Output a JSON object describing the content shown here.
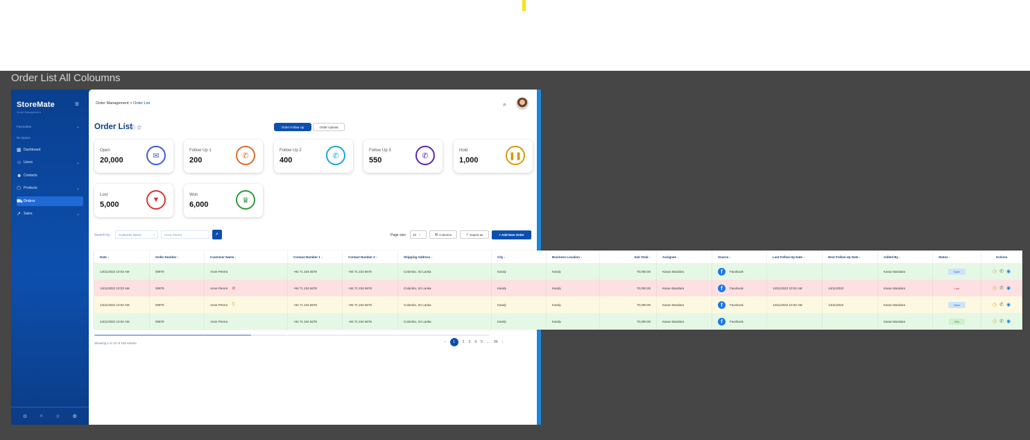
{
  "frame_title": "Order List All Coloumns",
  "sidebar": {
    "logo": "StoreMate",
    "logo_sub": "Order Management",
    "items": [
      {
        "label": "Favourites"
      },
      {
        "label": "No Space"
      },
      {
        "label": "Dashboard"
      },
      {
        "label": "Users"
      },
      {
        "label": "Contacts"
      },
      {
        "label": "Products"
      },
      {
        "label": "Orders"
      },
      {
        "label": "Sales"
      }
    ]
  },
  "header": {
    "breadcrumb_root": "Order Management",
    "breadcrumb_sep": ">",
    "breadcrumb_current": "Order List"
  },
  "page": {
    "title": "Order List",
    "tabs": [
      "Order Follow Up",
      "Order Upload"
    ]
  },
  "stats": [
    {
      "label": "Open",
      "value": "20,000",
      "color": "#3d5bd9"
    },
    {
      "label": "Follow Up 1",
      "value": "200",
      "color": "#e06a2c"
    },
    {
      "label": "Follow Up 2",
      "value": "400",
      "color": "#1aa6d8"
    },
    {
      "label": "Follow Up 3",
      "value": "550",
      "color": "#5a23b3"
    },
    {
      "label": "Hold",
      "value": "1,000",
      "color": "#d49a0d"
    },
    {
      "label": "Lost",
      "value": "5,000",
      "color": "#d93434"
    },
    {
      "label": "Won",
      "value": "6,000",
      "color": "#2e9a3a"
    }
  ],
  "toolbar": {
    "search_by": "Search by",
    "search_field": "Customer Name",
    "search_placeholder": "Anne Perera",
    "page_size_label": "Page size",
    "page_size_value": "10",
    "columns_label": "Columns",
    "export_label": "Export as",
    "add_label": "+ Add New Order"
  },
  "table": {
    "headers": [
      "Date ↓",
      "Order Number ↓",
      "Customer Name ↓",
      "Contact Number 1 ↓",
      "Contact Number 2 ↓",
      "Shipping Address ↓",
      "City ↓",
      "Business Location ↓",
      "Sub Total ↓",
      "Assignee ↓",
      "Source ↓",
      "Last Follow Up Date ↓",
      "Next Follow Up Date ↓",
      "Added By ↓",
      "Status ↓",
      "Actions"
    ],
    "rows": [
      {
        "date": "14/11/2022 10:02 AM",
        "order": "00879",
        "customer": "Anne Perera",
        "c1": "+94 71 234 5678",
        "c2": "+94 71 234 5678",
        "address": "Colombo, Sri Lanka",
        "city": "Kandy",
        "location": "Kandy",
        "subtotal": "70,000.00",
        "assignee": "Kasun Bandara",
        "source": "Facebook",
        "last": "",
        "next": "",
        "added_by": "Kasun Bandara",
        "status": "Open",
        "bg": "#e5f8e5",
        "status_bg": "#cfe3fb",
        "status_color": "#2f5fb0"
      },
      {
        "date": "14/11/2022 10:02 AM",
        "order": "00879",
        "customer": "Anne Perera",
        "c1": "+94 71 234 5678",
        "c2": "+94 71 234 5678",
        "address": "Colombo, Sri Lanka",
        "city": "Kandy",
        "location": "Kandy",
        "subtotal": "70,000.00",
        "assignee": "Kasun Bandara",
        "source": "Facebook",
        "last": "14/11/2022 10:02 AM",
        "next": "14/11/2022",
        "added_by": "Kasun Bandara",
        "status": "Lost",
        "bg": "#fde0e2",
        "status_bg": "#fde0e2",
        "status_color": "#c7333a"
      },
      {
        "date": "14/11/2022 10:02 AM",
        "order": "00879",
        "customer": "Anne Perera",
        "c1": "+94 71 234 5678",
        "c2": "+94 71 234 5678",
        "address": "Colombo, Sri Lanka",
        "city": "Kandy",
        "location": "Kandy",
        "subtotal": "70,000.00",
        "assignee": "Kasun Bandara",
        "source": "Facebook",
        "last": "14/11/2022 10:02 AM",
        "next": "14/11/2022",
        "added_by": "Kasun Bandara",
        "status": "Open",
        "bg": "#fdf9e1",
        "status_bg": "#cfe3fb",
        "status_color": "#2f5fb0"
      },
      {
        "date": "14/11/2022 10:02 AM",
        "order": "00879",
        "customer": "Anne Perera",
        "c1": "+94 71 234 5678",
        "c2": "+94 71 234 5678",
        "address": "Colombo, Sri Lanka",
        "city": "Kandy",
        "location": "Kandy",
        "subtotal": "70,000.00",
        "assignee": "Kasun Bandara",
        "source": "Facebook",
        "last": "",
        "next": "",
        "added_by": "Kasun Bandara",
        "status": "Win",
        "bg": "#e5f8e5",
        "status_bg": "#cdf2cd",
        "status_color": "#2c8a2c"
      }
    ]
  },
  "footer": {
    "showing": "Showing 1 to 10 of 150 entries",
    "pages": [
      "1",
      "2",
      "3",
      "4",
      "5",
      "...",
      "99"
    ]
  }
}
